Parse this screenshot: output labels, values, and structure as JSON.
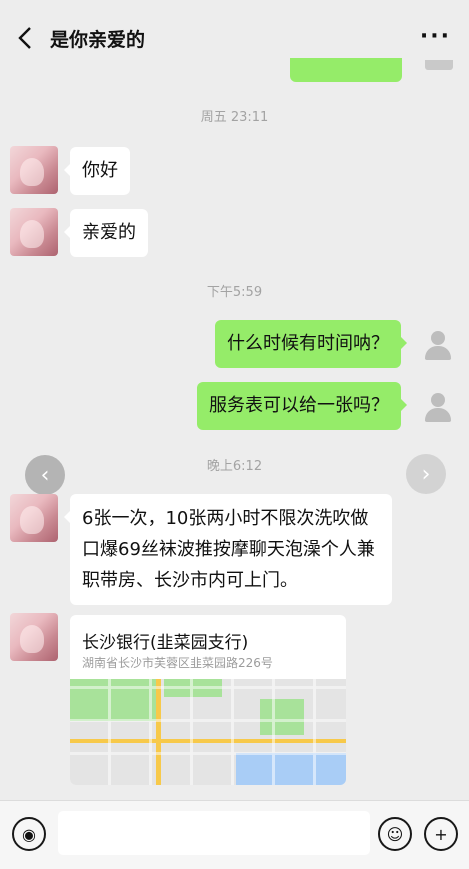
{
  "header": {
    "title": "是你亲爱的"
  },
  "timestamps": [
    "周五 23:11",
    "下午5:59",
    "晚上6:12"
  ],
  "messages": [
    {
      "side": "left",
      "text": "你好"
    },
    {
      "side": "left",
      "text": "亲爱的"
    },
    {
      "side": "right",
      "text": "什么时候有时间呐？"
    },
    {
      "side": "right",
      "text": "服务表可以给一张吗？"
    },
    {
      "side": "left",
      "text": "6张一次，10张两小时不限次洗吹做口爆69丝袜波推按摩聊天泡澡个人兼职带房、长沙市内可上门。"
    }
  ],
  "location": {
    "name": "长沙银行(韭菜园支行)",
    "address": "湖南省长沙市芙蓉区韭菜园路226号"
  },
  "icons": {
    "back": "chevron-left-icon",
    "more": "more-dots-icon",
    "voice": "voice-icon",
    "emoji": "emoji-icon",
    "add": "plus-icon"
  },
  "colors": {
    "background": "#ededed",
    "outgoing_bubble": "#95ec69",
    "incoming_bubble": "#ffffff"
  }
}
